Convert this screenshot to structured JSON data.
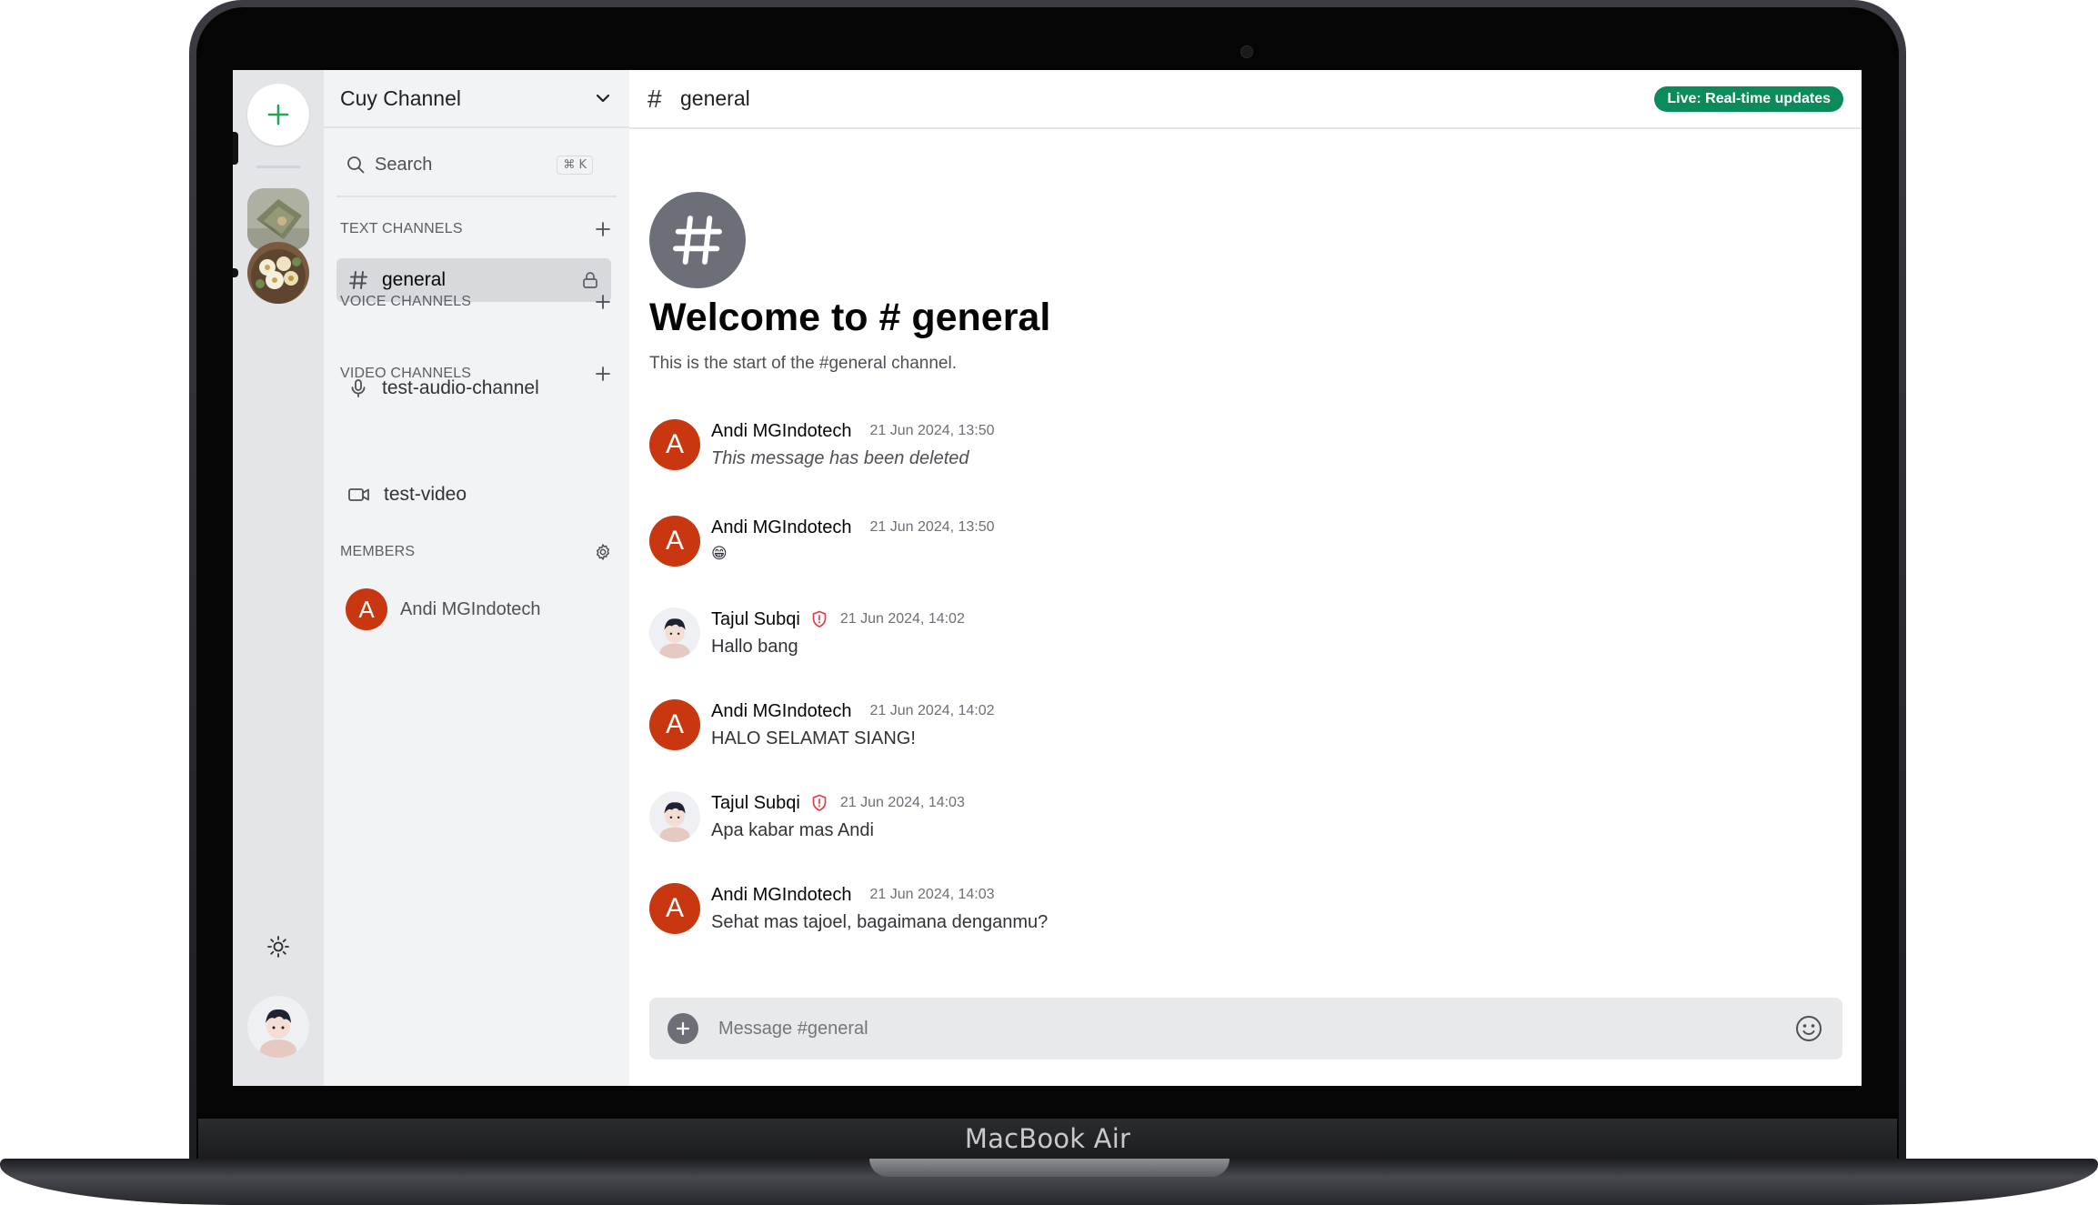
{
  "device": {
    "model_label": "MacBook Air"
  },
  "rail": {
    "add_server_label": "+",
    "servers": [
      "server-1",
      "server-2"
    ]
  },
  "sidebar": {
    "server_name": "Cuy Channel",
    "search": {
      "label": "Search",
      "shortcut": "⌘ K"
    },
    "sections": {
      "text": {
        "label": "TEXT CHANNELS",
        "channels": [
          {
            "name": "general",
            "locked": true,
            "active": true
          }
        ]
      },
      "voice": {
        "label": "VOICE CHANNELS",
        "channels": [
          {
            "name": "test-audio-channel"
          }
        ]
      },
      "video": {
        "label": "VIDEO CHANNELS",
        "channels": [
          {
            "name": "test-video"
          }
        ]
      },
      "members": {
        "label": "MEMBERS",
        "list": [
          {
            "initial": "A",
            "name": "Andi MGIndotech"
          }
        ]
      }
    }
  },
  "main": {
    "channel_hash": "#",
    "channel_name": "general",
    "live_badge": "Live: Real-time updates",
    "welcome_title": "Welcome to # general",
    "welcome_subtitle": "This is the start of the #general channel.",
    "messages": [
      {
        "author": "Andi MGIndotech",
        "initial": "A",
        "time": "21 Jun 2024, 13:50",
        "text": "This message has been deleted",
        "deleted": true
      },
      {
        "author": "Andi MGIndotech",
        "initial": "A",
        "time": "21 Jun 2024, 13:50",
        "text": "😁"
      },
      {
        "author": "Tajul Subqi",
        "admin": true,
        "time": "21 Jun 2024, 14:02",
        "text": "Hallo bang"
      },
      {
        "author": "Andi MGIndotech",
        "initial": "A",
        "time": "21 Jun 2024, 14:02",
        "text": "HALO SELAMAT SIANG!"
      },
      {
        "author": "Tajul Subqi",
        "admin": true,
        "time": "21 Jun 2024, 14:03",
        "text": "Apa kabar mas Andi"
      },
      {
        "author": "Andi MGIndotech",
        "initial": "A",
        "time": "21 Jun 2024, 14:03",
        "text": "Sehat mas tajoel, bagaimana denganmu?"
      }
    ],
    "composer": {
      "placeholder": "Message #general"
    }
  },
  "colors": {
    "accent_green": "#0b8a5a",
    "avatar_red": "#c8370f",
    "add_icon_green": "#23a55a",
    "admin_shield": "#e23b45"
  },
  "icons": [
    "plus-icon",
    "sun-icon",
    "chevron-down-icon",
    "search-icon",
    "hash-icon",
    "lock-icon",
    "microphone-icon",
    "video-camera-icon",
    "gear-icon",
    "shield-icon",
    "emoji-icon"
  ]
}
